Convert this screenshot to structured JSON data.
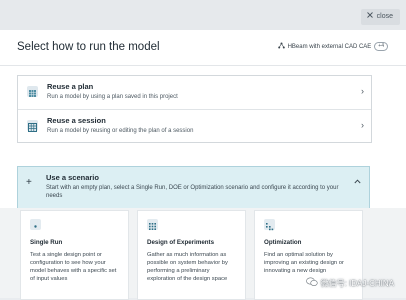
{
  "topbar": {
    "close_label": "close",
    "close_icon": "x-icon"
  },
  "dialog": {
    "title": "Select how to run the model",
    "engine": {
      "label": "HBeam with external CAD CAE",
      "count": "+4",
      "icon": "nodes-icon"
    }
  },
  "plans": [
    {
      "title": "Reuse a plan",
      "description": "Run a model by using a plan saved in this project",
      "icon": "grid-icon"
    },
    {
      "title": "Reuse a session",
      "description": "Run a model by reusing or editing the plan of a session",
      "icon": "table-icon"
    }
  ],
  "scenario": {
    "title": "Use a scenario",
    "description": "Start with an empty plan, select a Single Run, DOE or Optimization scenario and configure it according to your needs"
  },
  "cards": [
    {
      "title": "Single Run",
      "description": "Test a single design point or configuration to see how your model behaves with a specific set of input values",
      "icon": "point-icon"
    },
    {
      "title": "Design of Experiments",
      "description": "Gather as much information as possible on system behavior by performing a preliminary exploration of the design space",
      "icon": "grid-icon"
    },
    {
      "title": "Optimization",
      "description": "Find an optimal solution by improving an existing design or innovating a new design",
      "icon": "optimization-icon"
    }
  ],
  "watermark": {
    "text": "微信号: IDAJ-CHINA",
    "icon": "wechat-icon"
  },
  "colors": {
    "scenario_bg": "#dceff3",
    "accent": "#2f6f86"
  }
}
